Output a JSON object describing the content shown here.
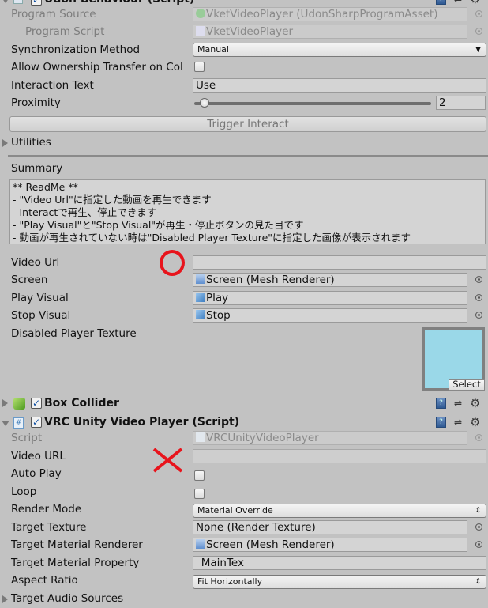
{
  "udon_behaviour": {
    "title": "Udon Behaviour (Script)",
    "fields": {
      "program_source": {
        "label": "Program Source",
        "value": "VketVideoPlayer (UdonSharpProgramAsset)"
      },
      "program_script": {
        "label": "Program Script",
        "value": "VketVideoPlayer"
      },
      "sync_method": {
        "label": "Synchronization Method",
        "value": "Manual"
      },
      "allow_ownership": {
        "label": "Allow Ownership Transfer on Col",
        "checked": false
      },
      "interaction_text": {
        "label": "Interaction Text",
        "value": "Use"
      },
      "proximity": {
        "label": "Proximity",
        "value": "2",
        "slider_fraction": 0.02
      }
    },
    "trigger_button": "Trigger Interact",
    "utilities_label": "Utilities",
    "summary_label": "Summary",
    "summary_lines": [
      "** ReadMe **",
      "- \"Video Url\"に指定した動画を再生できます",
      "- Interactで再生、停止できます",
      "- \"Play Visual\"と\"Stop Visual\"が再生・停止ボタンの見た目です",
      "- 動画が再生されていない時は\"Disabled Player Texture\"に指定した画像が表示されます"
    ],
    "video_url": {
      "label": "Video Url",
      "value": ""
    },
    "screen": {
      "label": "Screen",
      "value": "Screen (Mesh Renderer)"
    },
    "play_visual": {
      "label": "Play Visual",
      "value": "Play"
    },
    "stop_visual": {
      "label": "Stop Visual",
      "value": "Stop"
    },
    "disabled_texture": {
      "label": "Disabled Player Texture",
      "select_label": "Select",
      "color": "#9ad8e8"
    }
  },
  "box_collider": {
    "title": "Box Collider"
  },
  "vrc_video_player": {
    "title": "VRC Unity Video Player (Script)",
    "script": {
      "label": "Script",
      "value": "VRCUnityVideoPlayer"
    },
    "video_url": {
      "label": "Video URL",
      "value": ""
    },
    "auto_play": {
      "label": "Auto Play",
      "checked": false
    },
    "loop": {
      "label": "Loop",
      "checked": false
    },
    "render_mode": {
      "label": "Render Mode",
      "value": "Material Override"
    },
    "target_texture": {
      "label": "Target Texture",
      "value": "None (Render Texture)"
    },
    "target_material_renderer": {
      "label": "Target Material Renderer",
      "value": "Screen (Mesh Renderer)"
    },
    "target_material_property": {
      "label": "Target Material Property",
      "value": "_MainTex"
    },
    "aspect_ratio": {
      "label": "Aspect Ratio",
      "value": "Fit Horizontally"
    },
    "target_audio_sources": {
      "label": "Target Audio Sources"
    }
  },
  "annotations": {
    "circle_color": "#e8141c",
    "cross_color": "#e8141c"
  }
}
